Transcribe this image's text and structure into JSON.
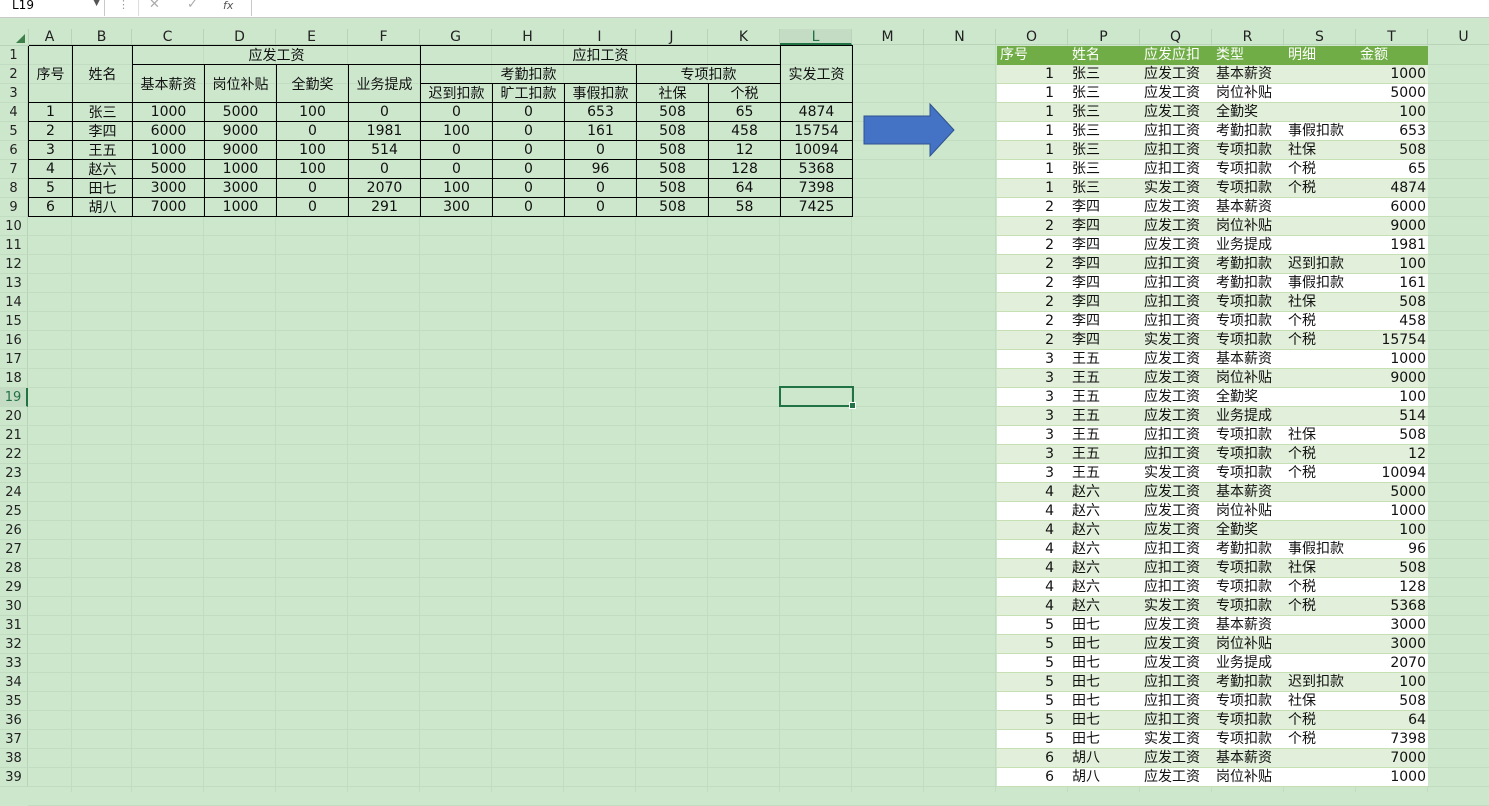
{
  "formula_bar": {
    "name_box": "L19",
    "cancel_icon": "✕",
    "confirm_icon": "✓",
    "fx_label": "fx",
    "formula": ""
  },
  "columns": [
    "A",
    "B",
    "C",
    "D",
    "E",
    "F",
    "G",
    "H",
    "I",
    "J",
    "K",
    "L",
    "M",
    "N",
    "O",
    "P",
    "Q",
    "R",
    "S",
    "T",
    "U"
  ],
  "selected_column": "L",
  "selected_row": 19,
  "rows": [
    1,
    2,
    3,
    4,
    5,
    6,
    7,
    8,
    9,
    10,
    11,
    12,
    13,
    14,
    15,
    16,
    17,
    18,
    19,
    20,
    21,
    22,
    23,
    24,
    25,
    26,
    27,
    28,
    29,
    30,
    31,
    32,
    33,
    34,
    35,
    36,
    37,
    38,
    39
  ],
  "source_table": {
    "header_serial": "序号",
    "header_name": "姓名",
    "group_gross": "应发工资",
    "group_deduct": "应扣工资",
    "group_attendance": "考勤扣款",
    "group_special": "专项扣款",
    "header_net": "实发工资",
    "sub_headers": [
      "基本薪资",
      "岗位补贴",
      "全勤奖",
      "业务提成",
      "迟到扣款",
      "旷工扣款",
      "事假扣款",
      "社保",
      "个税"
    ],
    "data": [
      [
        "1",
        "张三",
        "1000",
        "5000",
        "100",
        "0",
        "0",
        "0",
        "653",
        "508",
        "65",
        "4874"
      ],
      [
        "2",
        "李四",
        "6000",
        "9000",
        "0",
        "1981",
        "100",
        "0",
        "161",
        "508",
        "458",
        "15754"
      ],
      [
        "3",
        "王五",
        "1000",
        "9000",
        "100",
        "514",
        "0",
        "0",
        "0",
        "508",
        "12",
        "10094"
      ],
      [
        "4",
        "赵六",
        "5000",
        "1000",
        "100",
        "0",
        "0",
        "0",
        "96",
        "508",
        "128",
        "5368"
      ],
      [
        "5",
        "田七",
        "3000",
        "3000",
        "0",
        "2070",
        "100",
        "0",
        "0",
        "508",
        "64",
        "7398"
      ],
      [
        "6",
        "胡八",
        "7000",
        "1000",
        "0",
        "291",
        "300",
        "0",
        "0",
        "508",
        "58",
        "7425"
      ]
    ]
  },
  "output_table": {
    "headers": [
      "序号",
      "姓名",
      "应发应扣",
      "类型",
      "明细",
      "金额"
    ],
    "rows": [
      [
        "1",
        "张三",
        "应发工资",
        "基本薪资",
        "",
        "1000"
      ],
      [
        "1",
        "张三",
        "应发工资",
        "岗位补贴",
        "",
        "5000"
      ],
      [
        "1",
        "张三",
        "应发工资",
        "全勤奖",
        "",
        "100"
      ],
      [
        "1",
        "张三",
        "应扣工资",
        "考勤扣款",
        "事假扣款",
        "653"
      ],
      [
        "1",
        "张三",
        "应扣工资",
        "专项扣款",
        "社保",
        "508"
      ],
      [
        "1",
        "张三",
        "应扣工资",
        "专项扣款",
        "个税",
        "65"
      ],
      [
        "1",
        "张三",
        "实发工资",
        "专项扣款",
        "个税",
        "4874"
      ],
      [
        "2",
        "李四",
        "应发工资",
        "基本薪资",
        "",
        "6000"
      ],
      [
        "2",
        "李四",
        "应发工资",
        "岗位补贴",
        "",
        "9000"
      ],
      [
        "2",
        "李四",
        "应发工资",
        "业务提成",
        "",
        "1981"
      ],
      [
        "2",
        "李四",
        "应扣工资",
        "考勤扣款",
        "迟到扣款",
        "100"
      ],
      [
        "2",
        "李四",
        "应扣工资",
        "考勤扣款",
        "事假扣款",
        "161"
      ],
      [
        "2",
        "李四",
        "应扣工资",
        "专项扣款",
        "社保",
        "508"
      ],
      [
        "2",
        "李四",
        "应扣工资",
        "专项扣款",
        "个税",
        "458"
      ],
      [
        "2",
        "李四",
        "实发工资",
        "专项扣款",
        "个税",
        "15754"
      ],
      [
        "3",
        "王五",
        "应发工资",
        "基本薪资",
        "",
        "1000"
      ],
      [
        "3",
        "王五",
        "应发工资",
        "岗位补贴",
        "",
        "9000"
      ],
      [
        "3",
        "王五",
        "应发工资",
        "全勤奖",
        "",
        "100"
      ],
      [
        "3",
        "王五",
        "应发工资",
        "业务提成",
        "",
        "514"
      ],
      [
        "3",
        "王五",
        "应扣工资",
        "专项扣款",
        "社保",
        "508"
      ],
      [
        "3",
        "王五",
        "应扣工资",
        "专项扣款",
        "个税",
        "12"
      ],
      [
        "3",
        "王五",
        "实发工资",
        "专项扣款",
        "个税",
        "10094"
      ],
      [
        "4",
        "赵六",
        "应发工资",
        "基本薪资",
        "",
        "5000"
      ],
      [
        "4",
        "赵六",
        "应发工资",
        "岗位补贴",
        "",
        "1000"
      ],
      [
        "4",
        "赵六",
        "应发工资",
        "全勤奖",
        "",
        "100"
      ],
      [
        "4",
        "赵六",
        "应扣工资",
        "考勤扣款",
        "事假扣款",
        "96"
      ],
      [
        "4",
        "赵六",
        "应扣工资",
        "专项扣款",
        "社保",
        "508"
      ],
      [
        "4",
        "赵六",
        "应扣工资",
        "专项扣款",
        "个税",
        "128"
      ],
      [
        "4",
        "赵六",
        "实发工资",
        "专项扣款",
        "个税",
        "5368"
      ],
      [
        "5",
        "田七",
        "应发工资",
        "基本薪资",
        "",
        "3000"
      ],
      [
        "5",
        "田七",
        "应发工资",
        "岗位补贴",
        "",
        "3000"
      ],
      [
        "5",
        "田七",
        "应发工资",
        "业务提成",
        "",
        "2070"
      ],
      [
        "5",
        "田七",
        "应扣工资",
        "考勤扣款",
        "迟到扣款",
        "100"
      ],
      [
        "5",
        "田七",
        "应扣工资",
        "专项扣款",
        "社保",
        "508"
      ],
      [
        "5",
        "田七",
        "应扣工资",
        "专项扣款",
        "个税",
        "64"
      ],
      [
        "5",
        "田七",
        "实发工资",
        "专项扣款",
        "个税",
        "7398"
      ],
      [
        "6",
        "胡八",
        "应发工资",
        "基本薪资",
        "",
        "7000"
      ],
      [
        "6",
        "胡八",
        "应发工资",
        "岗位补贴",
        "",
        "1000"
      ]
    ]
  },
  "colors": {
    "sheet_bg": "#cde7cd",
    "header_bg": "#70ad47",
    "band_light": "#e2efda",
    "arrow": "#4472c4",
    "selection": "#217346"
  }
}
